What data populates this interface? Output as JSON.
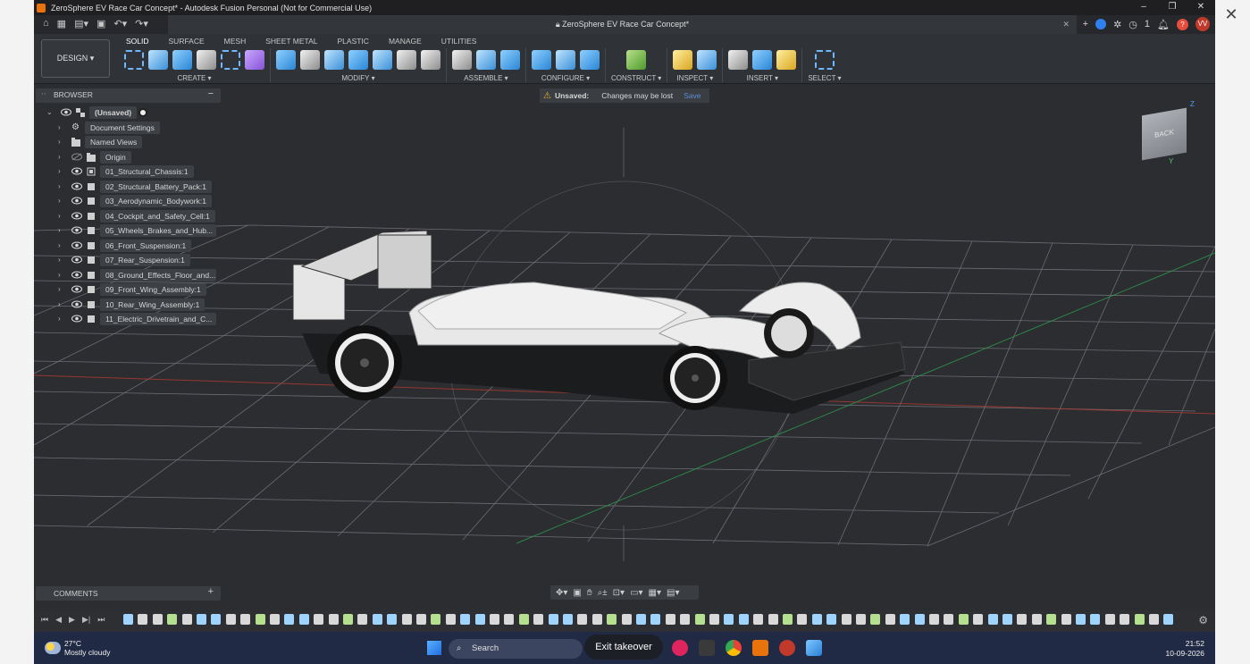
{
  "window": {
    "title": "ZeroSphere EV Race Car Concept* - Autodesk Fusion Personal (Not for Commercial Use)",
    "controls": [
      "–",
      "❐",
      "✕"
    ],
    "outer_close": "✕"
  },
  "doc_tab": {
    "title": "ZeroSphere EV Race Car Concept*",
    "close": "✕",
    "notification_count": "1",
    "avatar": "VV"
  },
  "ribbon": {
    "workspace": "DESIGN",
    "tabs": [
      "SOLID",
      "SURFACE",
      "MESH",
      "SHEET METAL",
      "PLASTIC",
      "MANAGE",
      "UTILITIES"
    ],
    "groups": [
      {
        "label": "CREATE",
        "icons": [
          "new-component",
          "extrude",
          "revolve",
          "hole",
          "rectangle",
          "form"
        ]
      },
      {
        "label": "MODIFY",
        "icons": [
          "press-pull",
          "fillet",
          "shell",
          "combine",
          "split",
          "move",
          "align"
        ]
      },
      {
        "label": "ASSEMBLE",
        "icons": [
          "new-component",
          "joint",
          "as-built-joint"
        ]
      },
      {
        "label": "CONFIGURE",
        "icons": [
          "configure-a",
          "configure-b",
          "configure-c"
        ]
      },
      {
        "label": "CONSTRUCT",
        "icons": [
          "offset-plane"
        ]
      },
      {
        "label": "INSPECT",
        "icons": [
          "measure",
          "section-analysis"
        ]
      },
      {
        "label": "INSERT",
        "icons": [
          "insert-mesh",
          "decal",
          "canvas"
        ]
      },
      {
        "label": "SELECT",
        "icons": [
          "window-select"
        ]
      }
    ]
  },
  "browser": {
    "title": "BROWSER",
    "root": "(Unsaved)",
    "items": [
      {
        "label": "Document Settings",
        "kind": "settings"
      },
      {
        "label": "Named Views",
        "kind": "views"
      },
      {
        "label": "Origin",
        "kind": "origin"
      },
      {
        "label": "01_Structural_Chassis:1",
        "kind": "component"
      },
      {
        "label": "02_Structural_Battery_Pack:1",
        "kind": "component"
      },
      {
        "label": "03_Aerodynamic_Bodywork:1",
        "kind": "component"
      },
      {
        "label": "04_Cockpit_and_Safety_Cell:1",
        "kind": "component"
      },
      {
        "label": "05_Wheels_Brakes_and_Hub...",
        "kind": "component"
      },
      {
        "label": "06_Front_Suspension:1",
        "kind": "component"
      },
      {
        "label": "07_Rear_Suspension:1",
        "kind": "component"
      },
      {
        "label": "08_Ground_Effects_Floor_and...",
        "kind": "component"
      },
      {
        "label": "09_Front_Wing_Assembly:1",
        "kind": "component"
      },
      {
        "label": "10_Rear_Wing_Assembly:1",
        "kind": "component"
      },
      {
        "label": "11_Electric_Drivetrain_and_C...",
        "kind": "component"
      }
    ]
  },
  "unsaved_banner": {
    "label": "Unsaved:",
    "message": "Changes may be lost",
    "action": "Save"
  },
  "viewcube": {
    "face": "BACK",
    "axis_z": "Z",
    "axis_y": "Y"
  },
  "comments": {
    "title": "COMMENTS",
    "add": "+"
  },
  "taskbar": {
    "temperature": "27°C",
    "weather": "Mostly cloudy",
    "search_placeholder": "Search",
    "exit_takeover": "Exit takeover",
    "time": "21:52",
    "date": "10-09-2026"
  },
  "colors": {
    "accent": "#2f80ed",
    "app_bg": "#2b2d31",
    "grid_line": "#8a8d93",
    "x_axis": "#c0392b",
    "z_axis": "#27ae60",
    "fusion_orange": "#e8720c"
  }
}
